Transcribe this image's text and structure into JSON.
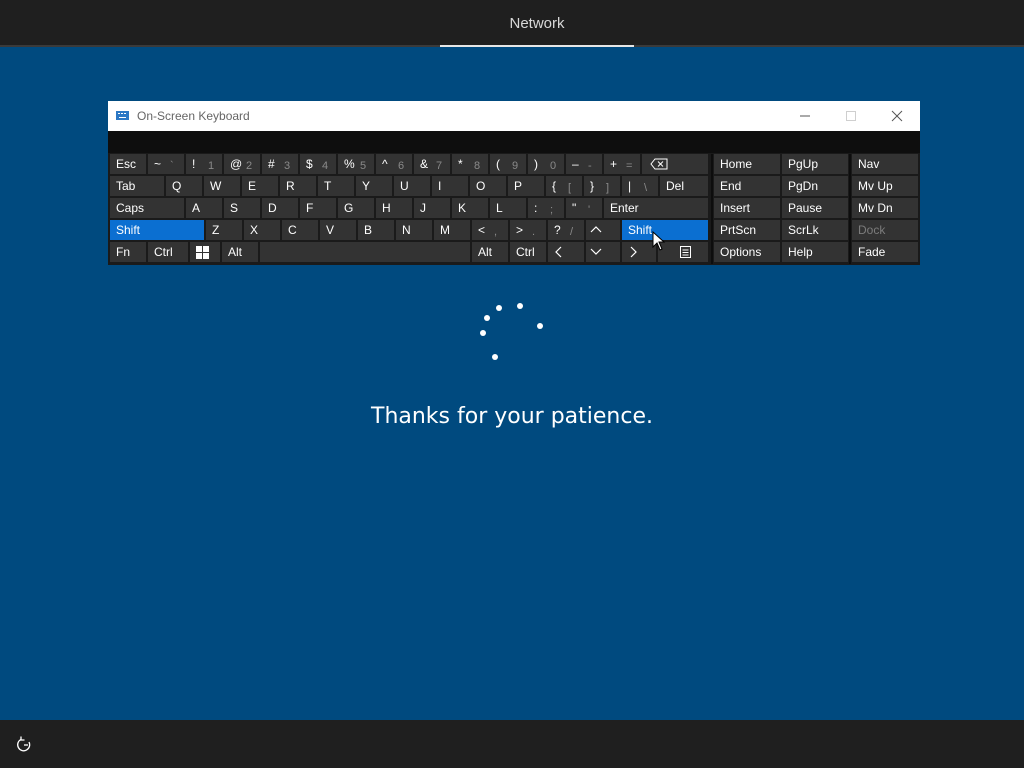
{
  "header": {
    "tab_label": "Network"
  },
  "osk": {
    "title": "On-Screen Keyboard",
    "row1": [
      {
        "top": "Esc"
      },
      {
        "top": "~",
        "bottom": "`"
      },
      {
        "top": "!",
        "bottom": "1"
      },
      {
        "top": "@",
        "bottom": "2"
      },
      {
        "top": "#",
        "bottom": "3"
      },
      {
        "top": "$",
        "bottom": "4"
      },
      {
        "top": "%",
        "bottom": "5"
      },
      {
        "top": "^",
        "bottom": "6"
      },
      {
        "top": "&",
        "bottom": "7"
      },
      {
        "top": "*",
        "bottom": "8"
      },
      {
        "top": "(",
        "bottom": "9"
      },
      {
        "top": ")",
        "bottom": "0"
      },
      {
        "top": "–",
        "bottom": "-"
      },
      {
        "top": "+",
        "bottom": "="
      }
    ],
    "row2": [
      "Tab",
      "Q",
      "W",
      "E",
      "R",
      "T",
      "Y",
      "U",
      "I",
      "O",
      "P"
    ],
    "row2_brackets": [
      {
        "top": "{",
        "bottom": "["
      },
      {
        "top": "}",
        "bottom": "]"
      },
      {
        "top": "|",
        "bottom": "\\"
      }
    ],
    "row2_del": "Del",
    "row3": [
      "Caps",
      "A",
      "S",
      "D",
      "F",
      "G",
      "H",
      "J",
      "K",
      "L"
    ],
    "row3_punct": [
      {
        "top": ":",
        "bottom": ";"
      },
      {
        "top": "\"",
        "bottom": "'"
      }
    ],
    "row3_enter": "Enter",
    "row4": [
      "Shift",
      "Z",
      "X",
      "C",
      "V",
      "B",
      "N",
      "M"
    ],
    "row4_punct": [
      {
        "top": "<",
        "bottom": ","
      },
      {
        "top": ">",
        "bottom": "."
      },
      {
        "top": "?",
        "bottom": "/"
      }
    ],
    "row4_shift_right": "Shift",
    "row5": {
      "fn": "Fn",
      "ctrl": "Ctrl",
      "alt": "Alt",
      "alt_right": "Alt",
      "ctrl_right": "Ctrl"
    },
    "nav": [
      [
        "Home",
        "PgUp"
      ],
      [
        "End",
        "PgDn"
      ],
      [
        "Insert",
        "Pause"
      ],
      [
        "PrtScn",
        "ScrLk"
      ],
      [
        "Options",
        "Help"
      ]
    ],
    "side": [
      "Nav",
      "Mv Up",
      "Mv Dn",
      "Dock",
      "Fade"
    ]
  },
  "message": "Thanks for your patience.",
  "colors": {
    "background": "#004a7f",
    "active_key": "#0b6fd1",
    "key": "#333333",
    "bar": "#1f1f1f"
  },
  "icons": {
    "ease_of_access": "ease-of-access-icon",
    "keyboard": "keyboard-icon",
    "windows": "windows-logo-icon",
    "menu": "context-menu-icon",
    "backspace": "backspace-icon"
  }
}
